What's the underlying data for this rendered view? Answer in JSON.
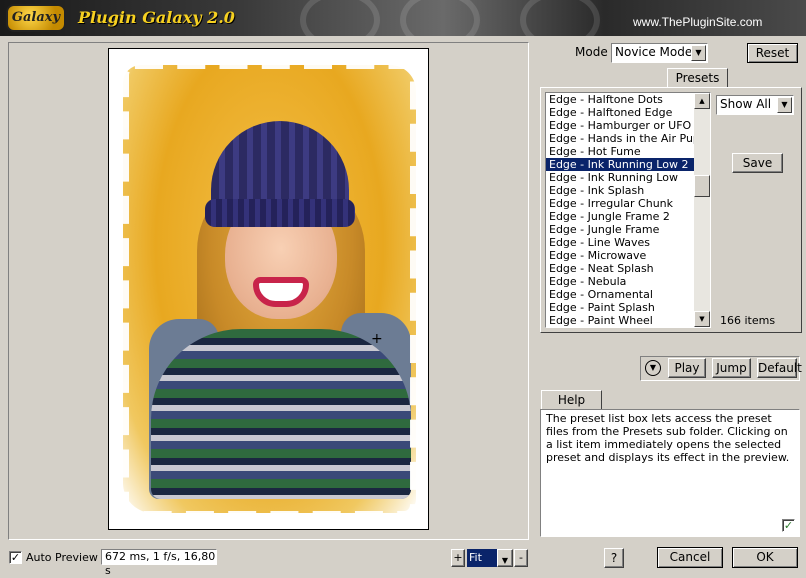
{
  "header": {
    "logo_text": "Galaxy",
    "app_title": "Plugin Galaxy 2.0",
    "site_url": "www.ThePluginSite.com"
  },
  "preview": {
    "auto_preview_label": "Auto Preview",
    "auto_preview_checked": true,
    "timing": "672 ms, 1 f/s, 16,80 s",
    "zoom": {
      "plus_label": "+",
      "value": "Fit",
      "minus_label": "-"
    }
  },
  "mode": {
    "label": "Mode",
    "value": "Novice Mode",
    "reset_label": "Reset"
  },
  "presets": {
    "tab_label": "Presets",
    "items": [
      "Edge - Halftone Dots",
      "Edge - Halftoned Edge",
      "Edge - Hamburger or UFO",
      "Edge - Hands in the Air Puppe",
      "Edge - Hot Fume",
      "Edge - Ink Running Low 2",
      "Edge - Ink Running Low",
      "Edge - Ink Splash",
      "Edge - Irregular Chunk",
      "Edge - Jungle Frame 2",
      "Edge - Jungle Frame",
      "Edge - Line Waves",
      "Edge - Microwave",
      "Edge - Neat Splash",
      "Edge - Nebula",
      "Edge - Ornamental",
      "Edge - Paint Splash",
      "Edge - Paint Wheel"
    ],
    "selected_index": 5,
    "filter_value": "Show All",
    "save_label": "Save",
    "count": "166 items"
  },
  "playback": {
    "play_label": "Play",
    "jump_label": "Jump",
    "default_label": "Default"
  },
  "help": {
    "tab_label": "Help",
    "text": "The preset list box lets access the preset files from the Presets sub folder. Clicking on a list item immediately opens the selected preset and displays its effect in the preview."
  },
  "footer": {
    "help_label": "?",
    "cancel_label": "Cancel",
    "ok_label": "OK"
  },
  "colors": {
    "selection": "#0a246a",
    "face": "#d4d0c8",
    "title_text": "#f6d020"
  }
}
